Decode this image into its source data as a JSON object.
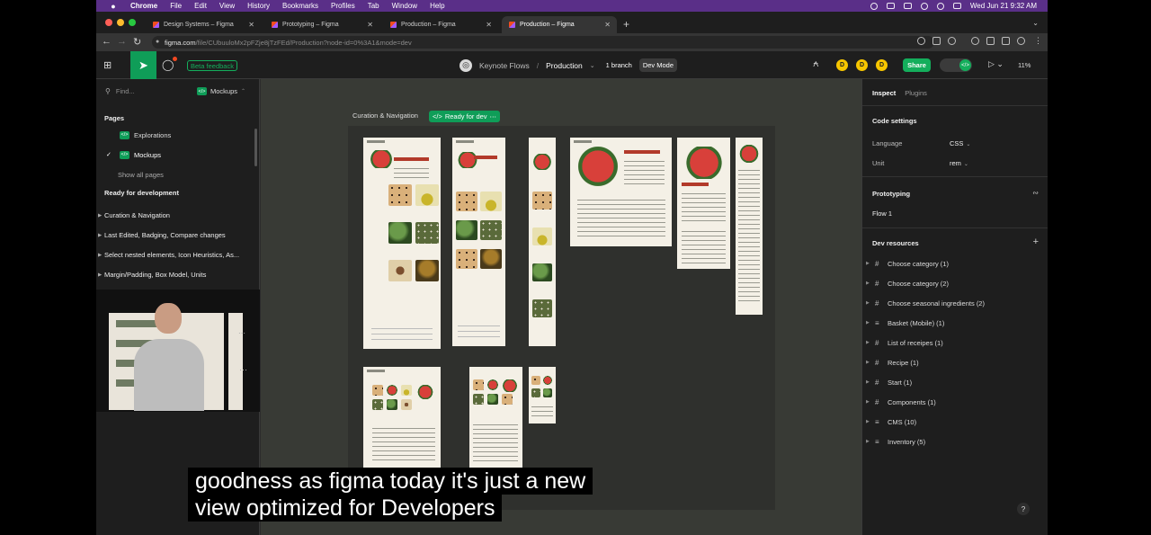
{
  "menubar": {
    "app": "Chrome",
    "items": [
      "File",
      "Edit",
      "View",
      "History",
      "Bookmarks",
      "Profiles",
      "Tab",
      "Window",
      "Help"
    ],
    "datetime": "Wed Jun 21  9:32 AM"
  },
  "browser": {
    "tabs": [
      {
        "title": "Design Systems – Figma",
        "active": false
      },
      {
        "title": "Prototyping – Figma",
        "active": false
      },
      {
        "title": "Production – Figma",
        "active": false
      },
      {
        "title": "Production – Figma",
        "active": true
      }
    ],
    "url_host": "figma.com",
    "url_path": "/file/CUbuuloMx2pFZje8jTzFEd/Production?node-id=0%3A1&mode=dev"
  },
  "toolbar": {
    "beta_label": "Beta feedback",
    "project": "Keynote Flows",
    "file": "Production",
    "branch": "1 branch",
    "mode": "Dev Mode",
    "avatars": [
      "D",
      "D",
      "D"
    ],
    "share_label": "Share",
    "zoom": "11%"
  },
  "left_panel": {
    "find_placeholder": "Find...",
    "current_page": "Mockups",
    "pages_heading": "Pages",
    "pages": [
      {
        "label": "Explorations",
        "selected": false
      },
      {
        "label": "Mockups",
        "selected": true
      }
    ],
    "show_all": "Show all pages",
    "ready_heading": "Ready for development",
    "sections": [
      "Curation & Navigation",
      "Last Edited, Badging, Compare changes",
      "Select nested elements, Icon Heuristics, As...",
      "Margin/Padding, Box Model, Units"
    ]
  },
  "canvas": {
    "section_label": "Curation & Navigation",
    "status_label": "Ready for dev",
    "mock_title": "WorldWise",
    "mock_heading": "Watermelon"
  },
  "right_panel": {
    "tabs": [
      "Inspect",
      "Plugins"
    ],
    "code_settings": {
      "title": "Code settings",
      "language_label": "Language",
      "language_value": "CSS",
      "unit_label": "Unit",
      "unit_value": "rem"
    },
    "prototyping": {
      "title": "Prototyping",
      "flow": "Flow 1"
    },
    "dev_resources": {
      "title": "Dev resources",
      "items": [
        {
          "label": "Choose category (1)",
          "glyph": "#"
        },
        {
          "label": "Choose category (2)",
          "glyph": "#"
        },
        {
          "label": "Choose seasonal ingredients (2)",
          "glyph": "#"
        },
        {
          "label": "Basket (Mobile) (1)",
          "glyph": "≡"
        },
        {
          "label": "List of receipes (1)",
          "glyph": "#"
        },
        {
          "label": "Recipe (1)",
          "glyph": "#"
        },
        {
          "label": "Start (1)",
          "glyph": "#"
        },
        {
          "label": "Components (1)",
          "glyph": "#"
        },
        {
          "label": "CMS (10)",
          "glyph": "≡"
        },
        {
          "label": "Inventory (5)",
          "glyph": "≡"
        }
      ]
    },
    "help": "?"
  },
  "caption": {
    "line1": "goodness as figma today it's just a new",
    "line2": "view optimized for Developers"
  },
  "colors": {
    "accent": "#0f9d58",
    "share": "#14ae5c",
    "avatar": "#f7c600",
    "menubar": "#5a2f88"
  }
}
